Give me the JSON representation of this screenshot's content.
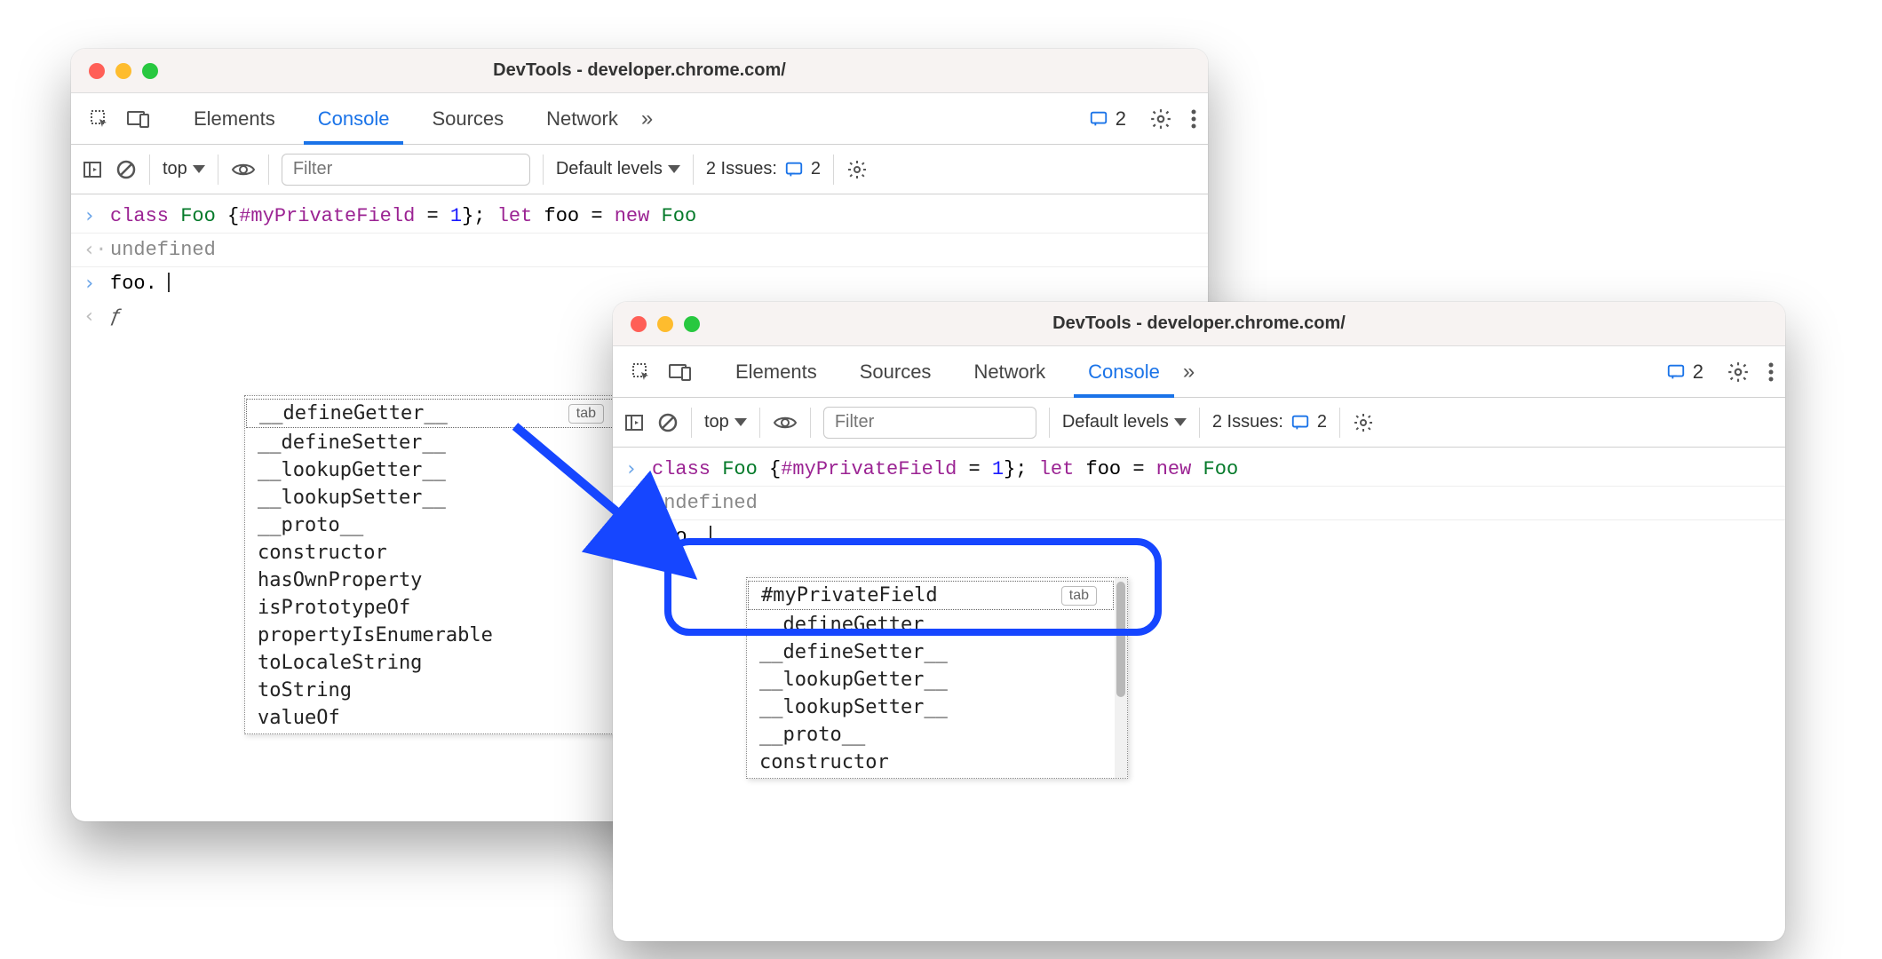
{
  "window1": {
    "title": "DevTools - developer.chrome.com/",
    "tabs": [
      "Elements",
      "Console",
      "Sources",
      "Network"
    ],
    "activeTab": "Console",
    "messageCount": "2",
    "toolbar": {
      "context": "top",
      "filterPlaceholder": "Filter",
      "levels": "Default levels",
      "issuesLabel": "2 Issues:",
      "issuesCount": "2"
    },
    "code": {
      "kw1": "class",
      "cls1": "Foo",
      "brace": "{",
      "prop": "#myPrivateField",
      "eq": " = ",
      "num": "1",
      "brace2": "};",
      "kw2": "let",
      "var": "foo",
      "eq2": " = ",
      "kw3": "new",
      "cls2": "Foo"
    },
    "output": "undefined",
    "typing": "foo.",
    "autocomplete": {
      "tabHint": "tab",
      "items": [
        "__defineGetter__",
        "__defineSetter__",
        "__lookupGetter__",
        "__lookupSetter__",
        "__proto__",
        "constructor",
        "hasOwnProperty",
        "isPrototypeOf",
        "propertyIsEnumerable",
        "toLocaleString",
        "toString",
        "valueOf"
      ]
    }
  },
  "window2": {
    "title": "DevTools - developer.chrome.com/",
    "tabs": [
      "Elements",
      "Sources",
      "Network",
      "Console"
    ],
    "activeTab": "Console",
    "messageCount": "2",
    "toolbar": {
      "context": "top",
      "filterPlaceholder": "Filter",
      "levels": "Default levels",
      "issuesLabel": "2 Issues:",
      "issuesCount": "2"
    },
    "code": {
      "kw1": "class",
      "cls1": "Foo",
      "brace": "{",
      "prop": "#myPrivateField",
      "eq": " = ",
      "num": "1",
      "brace2": "};",
      "kw2": "let",
      "var": "foo",
      "eq2": " = ",
      "kw3": "new",
      "cls2": "Foo"
    },
    "output": "undefined",
    "typing": "foo.",
    "autocomplete": {
      "tabHint": "tab",
      "items": [
        "#myPrivateField",
        "__defineGetter__",
        "__defineSetter__",
        "__lookupGetter__",
        "__lookupSetter__",
        "__proto__",
        "constructor"
      ]
    }
  }
}
